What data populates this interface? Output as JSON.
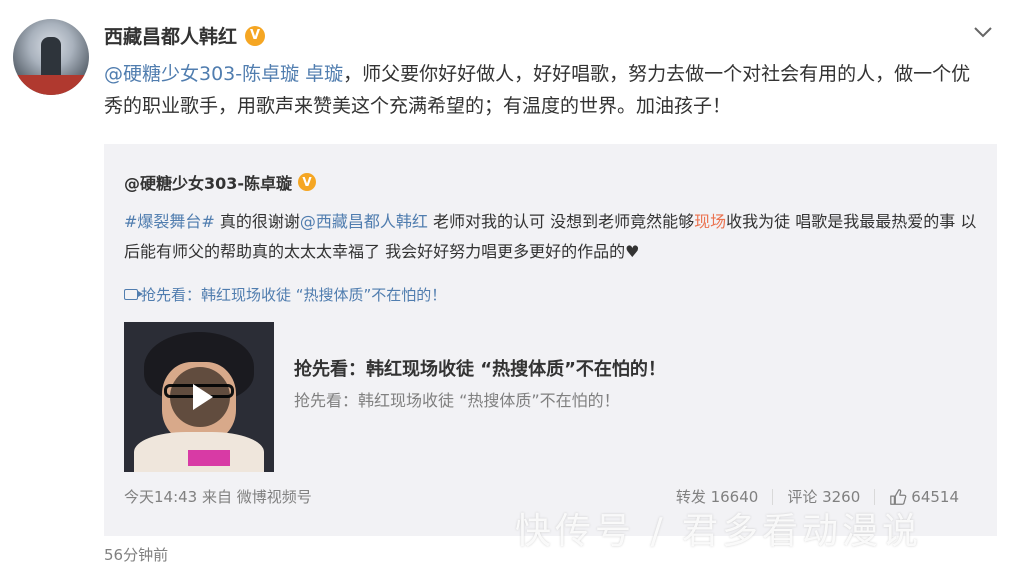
{
  "author": {
    "name": "西藏昌都人韩红",
    "verified_badge": "V"
  },
  "post": {
    "mention": "@硬糖少女303-陈卓璇 卓璇",
    "text": "，师父要你好好做人，好好唱歌，努力去做一个对社会有用的人，做一个优秀的职业歌手，用歌声来赞美这个充满希望的；有温度的世界。加油孩子！"
  },
  "quote": {
    "author": "@硬糖少女303-陈卓璇",
    "verified_badge": "V",
    "hashtag": "#爆裂舞台#",
    "text_1": " 真的很谢谢",
    "mention": "@西藏昌都人韩红",
    "text_2": " 老师对我的认可 没想到老师竟然能够",
    "highlight": "现场",
    "text_3": "收我为徒 唱歌是我最最热爱的事 以后能有师父的帮助真的太太太幸福了 我会好好努力唱更多更好的作品的♥",
    "video_link": "抢先看：韩红现场收徒 “热搜体质”不在怕的！",
    "card": {
      "title": "抢先看：韩红现场收徒 “热搜体质”不在怕的！",
      "subtitle": "抢先看：韩红现场收徒 “热搜体质”不在怕的！"
    },
    "meta": "今天14:43 来自 微博视频号",
    "stats": {
      "repost": "转发 16640",
      "comment": "评论 3260",
      "like": "64514"
    }
  },
  "timestamp": "56分钟前",
  "watermark": "快传号 / 君多看动漫说",
  "colors": {
    "link": "#507daf",
    "mention": "#eb7350",
    "badge": "#f5a623"
  }
}
